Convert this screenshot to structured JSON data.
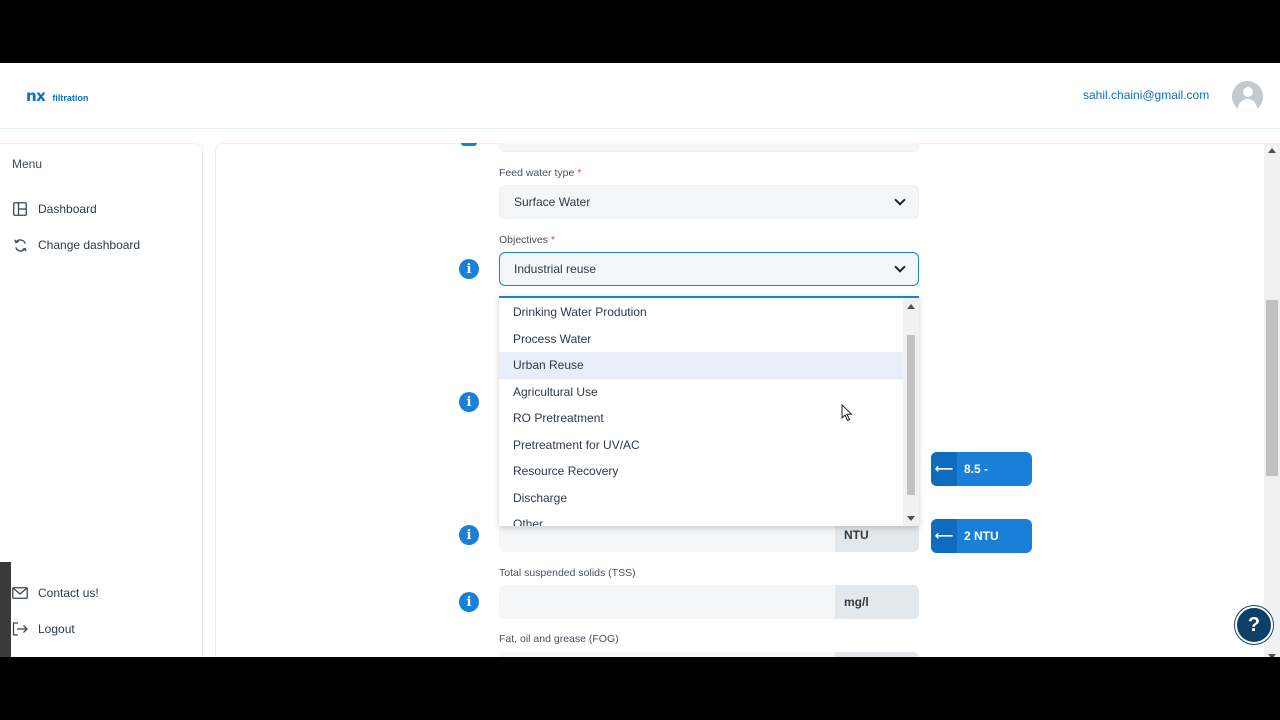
{
  "header": {
    "logo_mark": "nx",
    "logo_text": "filtration",
    "user_email": "sahil.chaini@gmail.com"
  },
  "sidebar": {
    "menu_title": "Menu",
    "items": [
      {
        "label": "Dashboard",
        "icon": "layout-icon"
      },
      {
        "label": "Change dashboard",
        "icon": "refresh-icon"
      }
    ],
    "bottom_items": [
      {
        "label": "Contact us!",
        "icon": "mail-icon"
      },
      {
        "label": "Logout",
        "icon": "logout-icon"
      }
    ]
  },
  "form": {
    "feed_water": {
      "label": "Feed water type",
      "required": "*",
      "value": "Surface Water"
    },
    "objectives": {
      "label": "Objectives",
      "required": "*",
      "value": "Industrial reuse"
    },
    "objectives_options": [
      "Drinking Water Prodution",
      "Process Water",
      "Urban Reuse",
      "Agricultural Use",
      "RO Pretreatment",
      "Pretreatment for UV/AC",
      "Resource Recovery",
      "Discharge",
      "Other"
    ],
    "hovered_option": "Urban Reuse",
    "ph_hint": "8.5 -",
    "turbidity": {
      "unit": "NTU",
      "hint": "2 NTU"
    },
    "tss": {
      "label": "Total suspended solids (TSS)",
      "unit": "mg/l"
    },
    "fog": {
      "label": "Fat, oil and grease (FOG)"
    }
  },
  "icons": {
    "info": "i",
    "arrow_left": "⟵",
    "help": "?"
  },
  "colors": {
    "accent": "#1a7fd6",
    "help_button": "#0e3f66",
    "required": "#e53935"
  }
}
